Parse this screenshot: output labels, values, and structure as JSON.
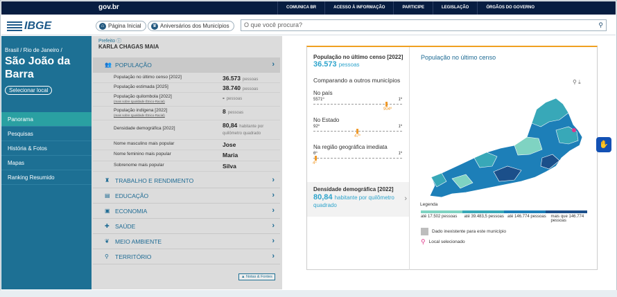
{
  "gov": {
    "logo": "gov.br",
    "links": [
      "COMUNICA BR",
      "ACESSO À INFORMAÇÃO",
      "PARTICIPE",
      "LEGISLAÇÃO",
      "ÓRGÃOS DO GOVERNO"
    ]
  },
  "header": {
    "brand": "IBGE",
    "home_label": "Página Inicial",
    "anniv_label": "Aniversários dos Municípios",
    "search_placeholder": "O que você procura?"
  },
  "left": {
    "breadcrumb": "Brasil / Rio de Janeiro /",
    "city": "São João da Barra",
    "select_local": "Selecionar local",
    "nav": [
      "Panorama",
      "Pesquisas",
      "História & Fotos",
      "Mapas",
      "Ranking Resumido"
    ]
  },
  "mayor": {
    "label": "Prefeito",
    "name": "KARLA CHAGAS MAIA"
  },
  "sections": [
    "POPULAÇÃO",
    "TRABALHO E RENDIMENTO",
    "EDUCAÇÃO",
    "ECONOMIA",
    "SAÚDE",
    "MEIO AMBIENTE",
    "TERRITÓRIO"
  ],
  "population_rows": [
    {
      "label": "População no último censo [2022]",
      "note": "",
      "value": "36.573",
      "unit": "pessoas"
    },
    {
      "label": "População estimada [2025]",
      "note": "",
      "value": "38.740",
      "unit": "pessoas"
    },
    {
      "label": "População quilombola [2022]",
      "note": "(mais sobre Igualdade Étnico-Racial)",
      "value": "-",
      "unit": "pessoas"
    },
    {
      "label": "População indígena [2022]",
      "note": "(mais sobre Igualdade Étnico-Racial)",
      "value": "8",
      "unit": "pessoas"
    },
    {
      "label": "Densidade demográfica [2022]",
      "note": "",
      "value": "80,84",
      "unit": "habitante por quilômetro quadrado"
    },
    {
      "label": "Nome masculino mais popular",
      "note": "",
      "value": "Jose",
      "unit": ""
    },
    {
      "label": "Nome feminino mais popular",
      "note": "",
      "value": "Maria",
      "unit": ""
    },
    {
      "label": "Sobrenome mais popular",
      "note": "",
      "value": "Silva",
      "unit": ""
    }
  ],
  "notes_button": "Notas & Fontes",
  "card": {
    "pop_title": "População no último censo [2022]",
    "pop_value": "36.573",
    "pop_unit": "pessoas",
    "compare_title": "Comparando a outros municípios",
    "ranks": [
      {
        "name": "No país",
        "left": "5571º",
        "right": "1º",
        "pos": "904º",
        "fraction": 0.84
      },
      {
        "name": "No Estado",
        "left": "92º",
        "right": "1º",
        "pos": "47º",
        "fraction": 0.5
      },
      {
        "name": "Na região geográfica imediata",
        "left": "6º",
        "right": "1º",
        "pos": "4º",
        "fraction": 0.02
      }
    ],
    "dens_title": "Densidade demográfica [2022]",
    "dens_value": "80,84",
    "dens_unit": "habitante por quilômetro quadrado"
  },
  "map": {
    "title": "População no último censo",
    "legend_title": "Legenda",
    "legend": [
      "até 17.502 pessoas",
      "até 39.483,5 pessoas",
      "até 146.774 pessoas",
      "mais que 146.774 pessoas"
    ],
    "legend_colors": [
      "#7fd3c2",
      "#38a8b8",
      "#1d7fb8",
      "#1b4f8a"
    ],
    "no_data": "Dado inexistente para este município",
    "selected": "Local selecionado"
  }
}
